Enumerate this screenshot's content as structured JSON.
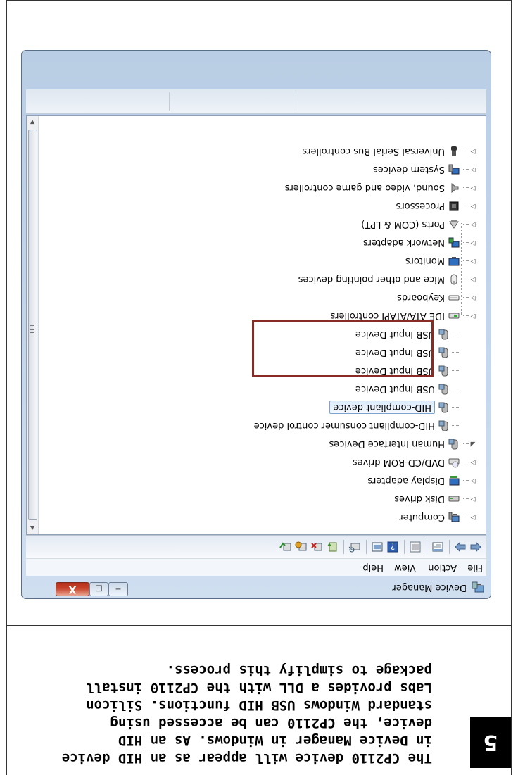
{
  "step_number": "5",
  "caption_lines": [
    "The CP2110 device will appear as an HID device",
    "in Device Manager in Windows. As an HID",
    "device, the CP2110 can be accessed using",
    "standard Windows USB HID functions. Silicon",
    "Labs provides a DLL with the CP2110 install",
    "package to simplify this process."
  ],
  "window": {
    "title": "Device Manager",
    "controls": {
      "minimize": "─",
      "maximize": "□",
      "close": "X"
    }
  },
  "menu": {
    "file": "File",
    "action": "Action",
    "view": "View",
    "help": "Help"
  },
  "toolbar_icons": [
    "back-arrow-icon",
    "forward-arrow-icon",
    "properties-icon",
    "refresh-icon",
    "help-icon",
    "show-hidden-icon",
    "scan-hardware-icon",
    "update-driver-icon",
    "uninstall-icon",
    "disable-icon",
    "enable-icon"
  ],
  "tree": {
    "computer": "Computer",
    "disk_drives": "Disk drives",
    "display_adapters": "Display adapters",
    "dvd_drives": "DVD/CD-ROM drives",
    "hid": "Human Interface Devices",
    "hid_children": [
      "HID-compliant consumer control device",
      "HID-compliant device",
      "USB Input Device",
      "USB Input Device",
      "USB Input Device",
      "USB Input Device"
    ],
    "ide": "IDE ATA/ATAPI controllers",
    "keyboards": "Keyboards",
    "mice": "Mice and other pointing devices",
    "monitors": "Monitors",
    "network": "Network adapters",
    "ports": "Ports (COM & LPT)",
    "processors": "Processors",
    "sound": "Sound, video and game controllers",
    "system": "System devices",
    "usb": "Universal Serial Bus controllers"
  },
  "colors": {
    "highlight_box": "#8a2a25",
    "selection": "#dcebfc",
    "close_button": "#c8432b"
  }
}
